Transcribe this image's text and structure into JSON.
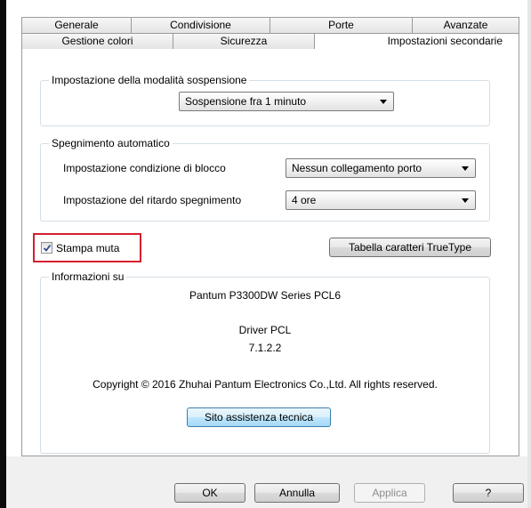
{
  "tabs_row1": [
    "Generale",
    "Condivisione",
    "Porte",
    "Avanzate"
  ],
  "tabs_row2": [
    "Gestione colori",
    "Sicurezza",
    "Impostazioni secondarie"
  ],
  "sleep_group": {
    "legend": "Impostazione della modalità sospensione",
    "value": "Sospensione fra 1 minuto"
  },
  "auto_off_group": {
    "legend": "Spegnimento automatico",
    "block_label": "Impostazione condizione di blocco",
    "block_value": "Nessun collegamento porto",
    "delay_label": "Impostazione del ritardo spegnimento",
    "delay_value": "4 ore"
  },
  "silent_print": {
    "label": "Stampa muta",
    "checked": true
  },
  "truetype_button": "Tabella caratteri TrueType",
  "info_group": {
    "legend": "Informazioni su",
    "model": "Pantum P3300DW Series PCL6",
    "driver": "Driver PCL",
    "version": "7.1.2.2",
    "copyright": "Copyright © 2016 Zhuhai Pantum Electronics Co.,Ltd. All rights reserved.",
    "support_button": "Sito assistenza tecnica"
  },
  "dialog_buttons": {
    "ok": "OK",
    "cancel": "Annulla",
    "apply": "Applica",
    "help": "?"
  },
  "colors": {
    "highlight_box": "#d3202e",
    "default_button": "#3c7fb1"
  }
}
